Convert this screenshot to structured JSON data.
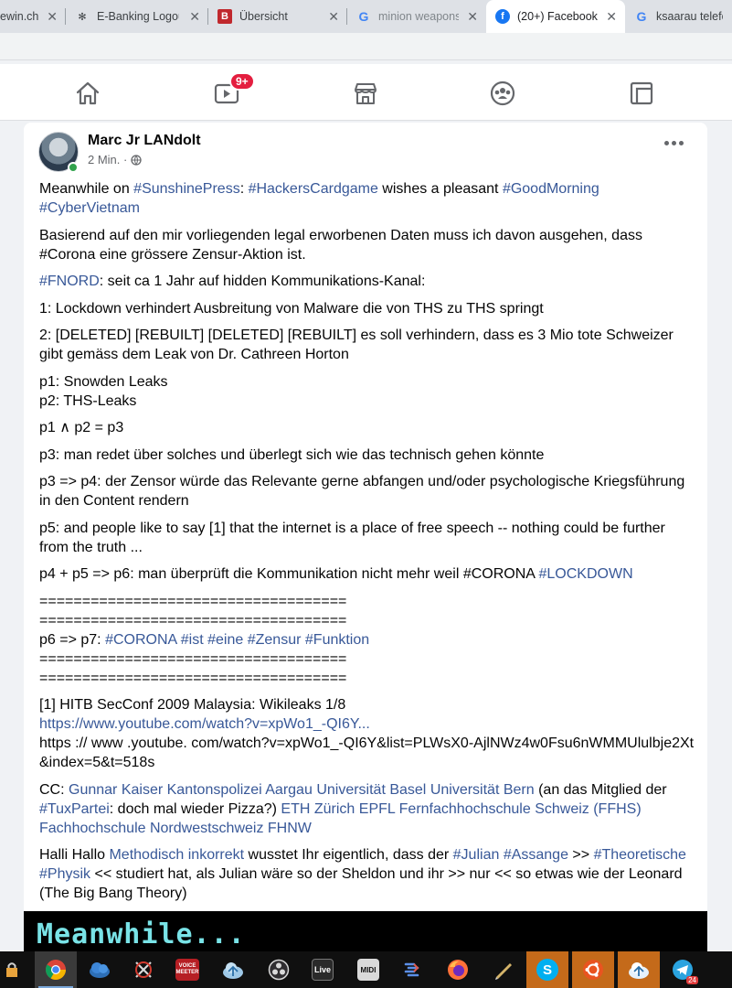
{
  "browser": {
    "tabs": [
      {
        "title": "ewin.ch",
        "icon": "website-favicon",
        "active": false
      },
      {
        "title": "E-Banking Logout",
        "icon": "bank-favicon",
        "active": false
      },
      {
        "title": "Übersicht",
        "icon": "b-favicon",
        "active": false
      },
      {
        "title": "minion weapons",
        "icon": "google-favicon",
        "active": false
      },
      {
        "title": "(20+) Facebook",
        "icon": "facebook-favicon",
        "active": true
      },
      {
        "title": "ksaarau telefon",
        "icon": "google-favicon",
        "active": false
      }
    ],
    "close_glyph": "✕"
  },
  "nav": {
    "items": [
      "home-icon",
      "watch-icon",
      "marketplace-icon",
      "groups-icon",
      "gaming-icon"
    ],
    "watch_badge": "9+"
  },
  "post": {
    "author": "Marc Jr LANdolt",
    "time": "2 Min. ·",
    "privacy_icon": "globe-icon",
    "image_text": "Meanwhile...",
    "paragraphs": {
      "p1": {
        "pre": "Meanwhile on ",
        "tag1": "#SunshinePress",
        "mid": ": ",
        "tag2": "#HackersCardgame",
        "mid2": " wishes a pleasant ",
        "tag3": "#GoodMorning",
        "tag4": "#CyberVietnam"
      },
      "p2": "Basierend auf den mir vorliegenden legal erworbenen Daten muss ich davon ausgehen, dass #Corona eine grössere Zensur-Aktion ist.",
      "p3": {
        "tag": "#FNORD",
        "rest": ": seit ca 1 Jahr auf hidden Kommunikations-Kanal:"
      },
      "p4": "1: Lockdown verhindert Ausbreitung von Malware die von THS zu THS springt",
      "p5": "2: [DELETED] [REBUILT] [DELETED] [REBUILT] es soll verhindern, dass es 3 Mio tote Schweizer gibt gemäss dem Leak von Dr. Cathreen Horton",
      "p6a": "p1: Snowden Leaks",
      "p6b": "p2: THS-Leaks",
      "p7": "p1 ∧ p2 = p3",
      "p8": "p3: man redet über solches und überlegt sich wie das technisch gehen könnte",
      "p9": "p3 => p4: der Zensor würde das Relevante gerne abfangen und/oder psychologische Kriegsführung in den Content rendern",
      "p10": "p5: and people like to say [1] that the internet is a place of free speech -- nothing could be further from the truth ...",
      "p11": {
        "pre": "p4 + p5 => p6: man überprüft die Kommunikation nicht mehr weil #CORONA ",
        "tag": "#LOCKDOWN"
      },
      "sep": "====================================",
      "p12": {
        "pre": "p6 => p7: ",
        "t1": "#CORONA",
        "t2": "#ist",
        "t3": "#eine",
        "t4": "#Zensur",
        "t5": "#Funktion"
      },
      "p13": {
        "line1": "[1] HITB SecConf 2009 Malaysia: Wikileaks 1/8",
        "link": "https://www.youtube.com/watch?v=xpWo1_-QI6Y...",
        "line3": "https :// www .youtube. com/watch?v=xpWo1_-QI6Y&list=PLWsX0-AjlNWz4w0Fsu6nWMMUlulbje2Xt&index=5&t=518s"
      },
      "p14": {
        "pre": "CC: ",
        "l1": "Gunnar Kaiser",
        "l2": "Kantonspolizei Aargau",
        "l3": "Universität Basel",
        "l4": "Universität Bern",
        "mid": " (an das Mitglied der ",
        "l5": "#TuxPartei",
        "mid2": ": doch mal wieder Pizza?) ",
        "l6": "ETH Zürich",
        "l7": "EPFL",
        "l8": "Fernfachhochschule Schweiz (FFHS)",
        "l9": "Fachhochschule Nordwestschweiz FHNW"
      },
      "p15": {
        "pre": "Halli Hallo ",
        "l1": "Methodisch inkorrekt",
        "mid": " wusstet Ihr eigentlich, dass der ",
        "t1": "#Julian",
        "t2": "#Assange",
        "mid2": " >> ",
        "t3": "#Theoretische",
        "t4": "#Physik",
        "rest": " << studiert hat, als Julian wäre so der Sheldon und ihr >> nur << so etwas wie der Leonard (The Big Bang Theory)"
      }
    }
  },
  "taskbar": {
    "items": [
      "lock-icon",
      "chrome-icon",
      "cloud-icon",
      "tools-icon",
      "voicemeeter-icon",
      "cloud-drive-icon",
      "obs-icon",
      "live-icon",
      "midi-icon",
      "scrcpy-icon",
      "firefox-icon",
      "pen-icon",
      "skype-icon",
      "ubuntu-icon",
      "cloud-app-icon",
      "telegram-icon"
    ],
    "voicemeeter_label": "VOICE MEETER",
    "live_label": "Live",
    "midi_label": "MIDI",
    "skype_label": "S",
    "telegram_badge": "24"
  },
  "colors": {
    "link": "#385898",
    "facebook_blue": "#1877f2",
    "badge_red": "#e41e3f",
    "meanwhile_text": "#79e3e7"
  }
}
